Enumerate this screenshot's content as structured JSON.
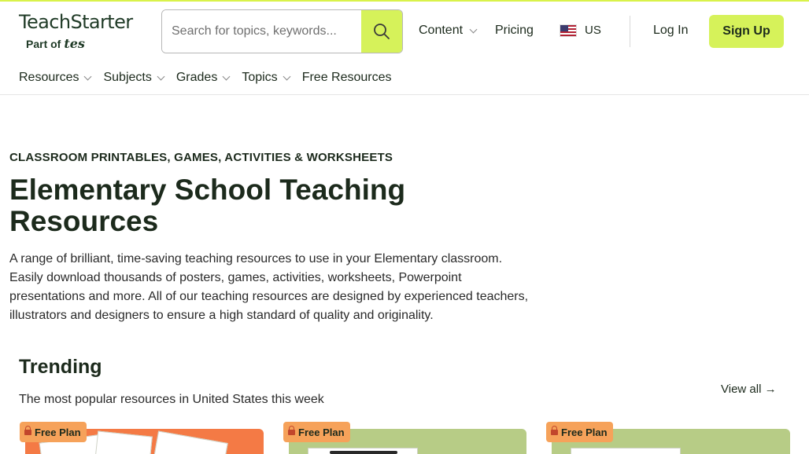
{
  "header": {
    "logo_text": "TeachStarter",
    "logo_part_of": "Part of",
    "logo_tes": "tes",
    "search_placeholder": "Search for topics, keywords...",
    "content_label": "Content",
    "pricing_label": "Pricing",
    "region_label": "US",
    "login_label": "Log In",
    "signup_label": "Sign Up"
  },
  "subnav": {
    "items": [
      {
        "label": "Resources"
      },
      {
        "label": "Subjects"
      },
      {
        "label": "Grades"
      },
      {
        "label": "Topics"
      },
      {
        "label": "Free Resources"
      }
    ]
  },
  "hero": {
    "kicker": "CLASSROOM PRINTABLES, GAMES, ACTIVITIES & WORKSHEETS",
    "title": "Elementary School Teaching Resources",
    "description": "A range of brilliant, time-saving teaching resources to use in your Elementary classroom. Easily download thousands of posters, games, activities, worksheets, Powerpoint presentations and more. All of our teaching resources are designed by experienced teachers, illustrators and designers to ensure a high standard of quality and originality."
  },
  "trending": {
    "title": "Trending",
    "subtitle": "The most popular resources in United States this week",
    "view_all": "View all →",
    "cards": [
      {
        "badge": "Free Plan",
        "color": "#f47a45"
      },
      {
        "badge": "Free Plan",
        "color": "#b7cc86"
      },
      {
        "badge": "Free Plan",
        "color": "#b7cc86"
      }
    ]
  },
  "colors": {
    "accent": "#d6f25a",
    "badge": "#f6a25a",
    "text": "#1c2a1c"
  }
}
